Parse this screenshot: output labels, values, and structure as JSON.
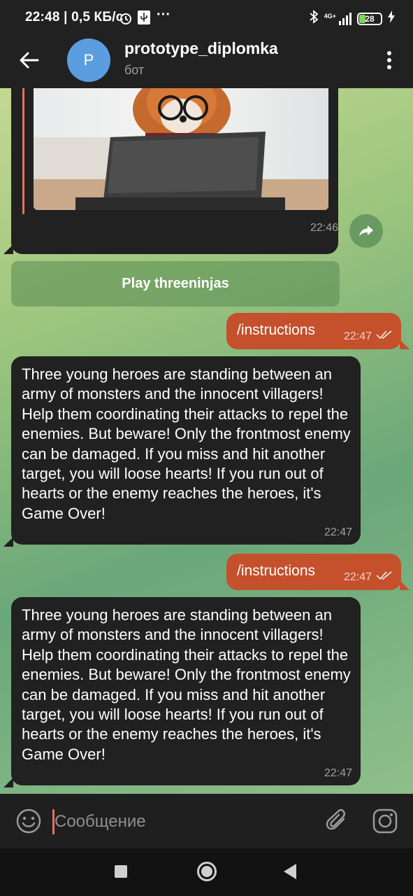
{
  "status_bar": {
    "time": "22:48 | 0,5 КБ/с",
    "network": "4G+",
    "battery": "28"
  },
  "header": {
    "avatar_letter": "P",
    "title": "prototype_diplomka",
    "subtitle": "бот"
  },
  "messages": {
    "photo_time": "22:46",
    "inline_button": "Play threeninjas",
    "cmd1": {
      "text": "/instructions",
      "time": "22:47"
    },
    "reply1": {
      "text": "Three young heroes are standing between an army of monsters and the innocent villagers! Help them coordinating their attacks to repel the enemies. But beware! Only the frontmost enemy can be damaged. If you miss and hit another target, you will loose hearts! If you run out of hearts or the enemy reaches the heroes, it's Game Over!",
      "time": "22:47"
    },
    "cmd2": {
      "text": "/instructions",
      "time": "22:47"
    },
    "reply2": {
      "text": "Three young heroes are standing between an army of monsters and the innocent villagers! Help them coordinating their attacks to repel the enemies. But beware! Only the frontmost enemy can be damaged. If you miss and hit another target, you will loose hearts! If you run out of hearts or the enemy reaches the heroes, it's Game Over!",
      "time": "22:47"
    }
  },
  "composer": {
    "placeholder": "Сообщение"
  },
  "colors": {
    "accent": "#c4502c",
    "incoming_bubble": "#212121",
    "bar": "#212121",
    "avatar": "#5b9ee0"
  },
  "icons": [
    "back-arrow-icon",
    "more-vert-icon",
    "share-icon",
    "double-check-icon",
    "emoji-icon",
    "attach-icon",
    "camera-icon",
    "alarm-icon",
    "usb-icon",
    "bluetooth-icon",
    "signal-icon",
    "battery-icon",
    "charging-icon"
  ]
}
